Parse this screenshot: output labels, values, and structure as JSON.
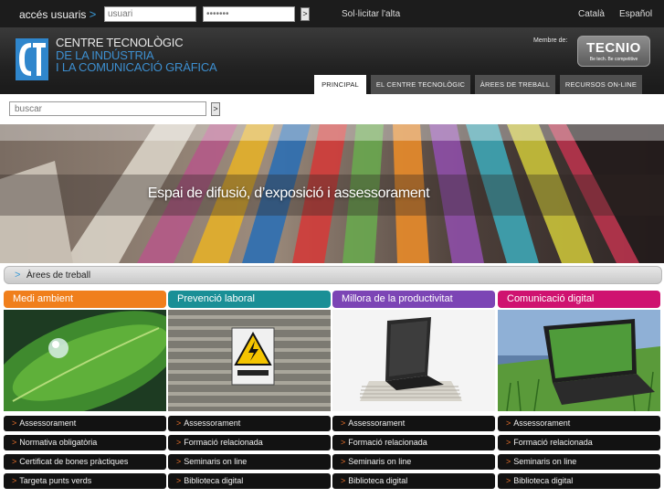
{
  "topbar": {
    "login_label": "accés usuaris",
    "login_arrow": ">",
    "username_placeholder": "usuari",
    "password_placeholder": "•••••••",
    "go_label": ">",
    "signup_link": "Sol·licitar l'alta",
    "languages": [
      "Català",
      "Español"
    ]
  },
  "header": {
    "logo_lines": [
      "CENTRE TECNOLÒGIC",
      "DE LA INDÚSTRIA",
      "I LA COMUNICACIÓ GRÀFICA"
    ],
    "member_label": "Membre de:",
    "tecnio_name": "TECNIO",
    "tecnio_tagline": "Be tech. Be competitive",
    "nav": [
      "PRINCIPAL",
      "EL CENTRE TECNOLÒGIC",
      "ÀREES DE TREBALL",
      "RECURSOS ON-LINE"
    ],
    "active_nav": "PRINCIPAL"
  },
  "search": {
    "placeholder": "buscar",
    "go_label": ">"
  },
  "banner": {
    "caption": "Espai de difusió, d’exposició i assessorament"
  },
  "areas": {
    "header_arrow": ">",
    "header_label": "Àrees de treball",
    "link_arrow": ">",
    "columns": [
      {
        "title": "Medi ambient",
        "color": "#f07f1c",
        "links": [
          "Assessorament",
          "Normativa obligatòria",
          "Certificat de bones pràctiques",
          "Targeta punts verds"
        ]
      },
      {
        "title": "Prevenció laboral",
        "color": "#1a8f96",
        "links": [
          "Assessorament",
          "Formació relacionada",
          "Seminaris on line",
          "Biblioteca digital"
        ]
      },
      {
        "title": "Millora de la productivitat",
        "color": "#7c45b5",
        "links": [
          "Assessorament",
          "Formació relacionada",
          "Seminaris on line",
          "Biblioteca digital"
        ]
      },
      {
        "title": "Comunicació digital",
        "color": "#cf1270",
        "links": [
          "Assessorament",
          "Formació relacionada",
          "Seminaris on line",
          "Biblioteca digital"
        ]
      }
    ]
  }
}
